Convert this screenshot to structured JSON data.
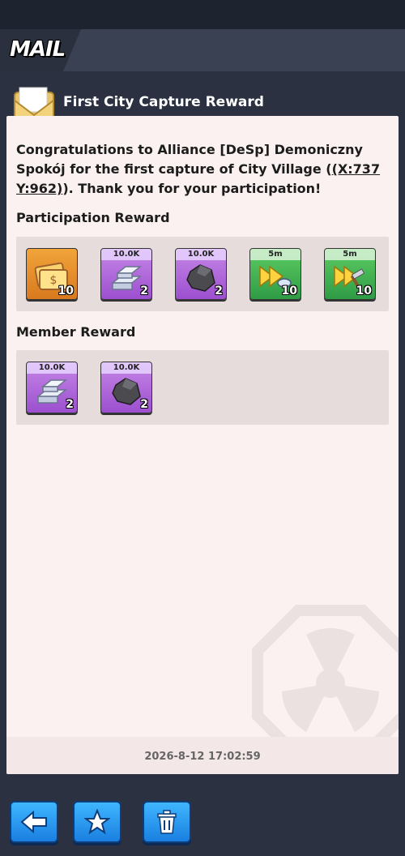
{
  "header": {
    "title": "MAIL"
  },
  "mail": {
    "subject": "First City Capture Reward",
    "message_before": "Congratulations to Alliance [DeSp] Demoniczny Spokój for the first capture of City Village (",
    "coords": "(X:737 Y:962)",
    "message_after": "). Thank you for your participation!",
    "date": "2026-8-12 17:02:59"
  },
  "participation": {
    "label": "Participation Reward",
    "items": [
      {
        "name": "gold-tickets",
        "tag": "",
        "count": "10",
        "color": "gold",
        "icon": "tickets-icon"
      },
      {
        "name": "iron-ingots",
        "tag": "10.0K",
        "count": "2",
        "color": "purple",
        "icon": "ingot-icon"
      },
      {
        "name": "stone",
        "tag": "10.0K",
        "count": "2",
        "color": "purple",
        "icon": "stone-icon"
      },
      {
        "name": "speedup-training",
        "tag": "5m",
        "count": "10",
        "color": "green",
        "icon": "speedup-icon"
      },
      {
        "name": "speedup-building",
        "tag": "5m",
        "count": "10",
        "color": "green",
        "icon": "hammer-speedup-icon"
      }
    ]
  },
  "member": {
    "label": "Member Reward",
    "items": [
      {
        "name": "iron-ingots",
        "tag": "10.0K",
        "count": "2",
        "color": "purple",
        "icon": "ingot-icon"
      },
      {
        "name": "stone",
        "tag": "10.0K",
        "count": "2",
        "color": "purple",
        "icon": "stone-icon"
      }
    ]
  },
  "buttons": {
    "back": "back-arrow-icon",
    "favorite": "star-icon",
    "delete": "trash-icon"
  }
}
